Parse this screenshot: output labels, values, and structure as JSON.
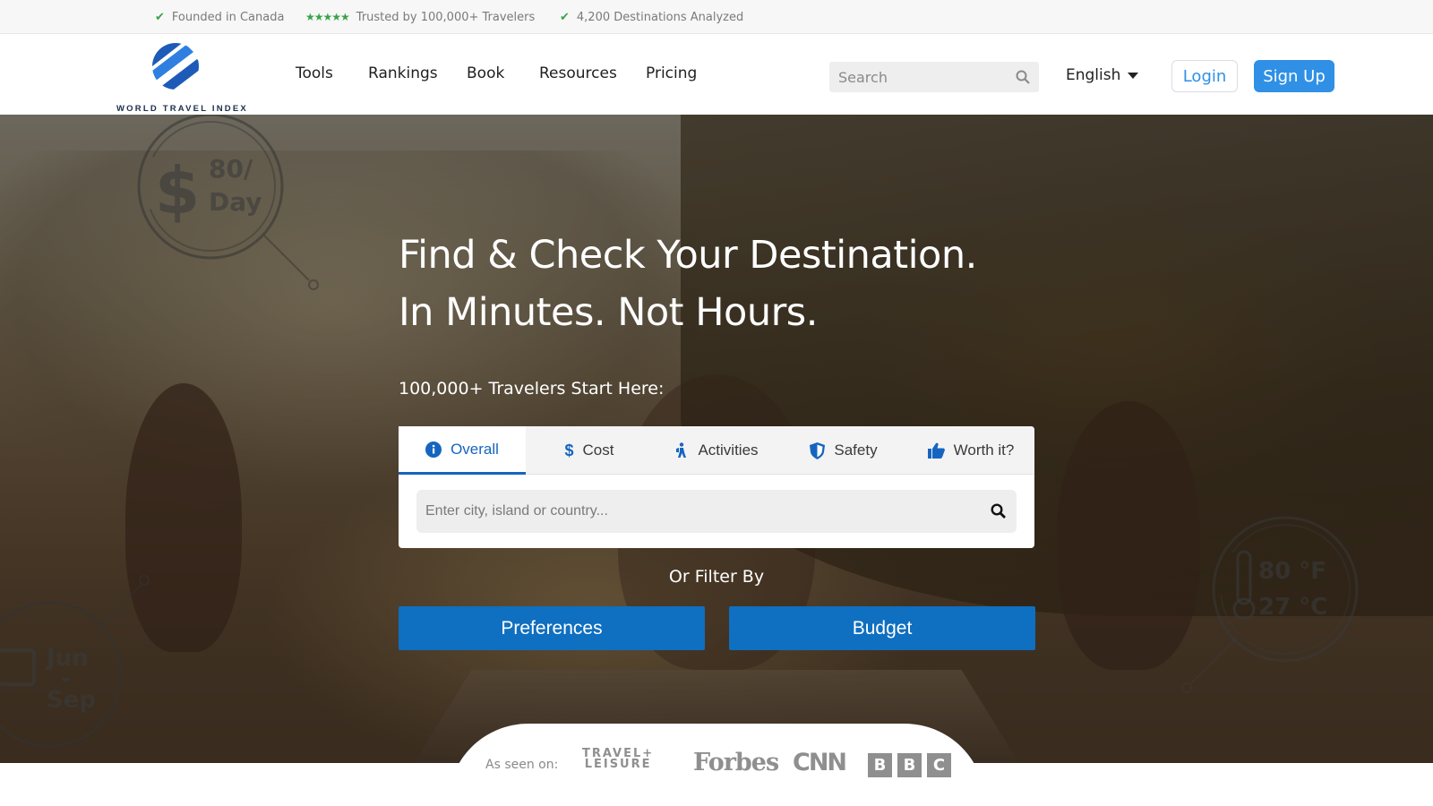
{
  "trust_bar": {
    "items": [
      {
        "icon": "check-icon",
        "text": "Founded in Canada"
      },
      {
        "icon": "stars-icon",
        "stars": "★★★★★",
        "text": "Trusted by 100,000+ Travelers"
      },
      {
        "icon": "check-icon",
        "text": "4,200 Destinations Analyzed"
      }
    ],
    "accent_color": "#3aa24a"
  },
  "header": {
    "logo_text": "WORLD TRAVEL INDEX",
    "nav": [
      "Tools",
      "Rankings",
      "Book",
      "Resources",
      "Pricing"
    ],
    "search_placeholder": "Search",
    "language": "English",
    "login_label": "Login",
    "signup_label": "Sign Up",
    "brand_color": "#2f90e6"
  },
  "hero": {
    "title_line1": "Find & Check Your Destination.",
    "title_line2": "In Minutes. Not Hours.",
    "subtitle": "100,000+ Travelers Start Here:",
    "tabs": [
      {
        "label": "Overall",
        "icon": "info-icon",
        "active": true
      },
      {
        "label": "Cost",
        "icon": "dollar-icon",
        "active": false
      },
      {
        "label": "Activities",
        "icon": "hiking-icon",
        "active": false
      },
      {
        "label": "Safety",
        "icon": "shield-icon",
        "active": false
      },
      {
        "label": "Worth it?",
        "icon": "thumbs-up-icon",
        "active": false
      }
    ],
    "destination_placeholder": "Enter city, island or country...",
    "filter_label": "Or Filter By",
    "filter_buttons": [
      "Preferences",
      "Budget"
    ],
    "decorations": {
      "cost_line1": "80/",
      "cost_line2": "Day",
      "temp_f": "80 °F",
      "temp_c": "27 °C",
      "months_top": "Jun",
      "months_dash": "-",
      "months_bottom": "Sep"
    }
  },
  "as_seen_on": {
    "label": "As seen on:",
    "brands": {
      "travel_leisure_1": "TRAVEL+",
      "travel_leisure_2": "LEISURE",
      "forbes": "Forbes",
      "cnn": "CNN",
      "bbc": [
        "B",
        "B",
        "C"
      ]
    }
  }
}
